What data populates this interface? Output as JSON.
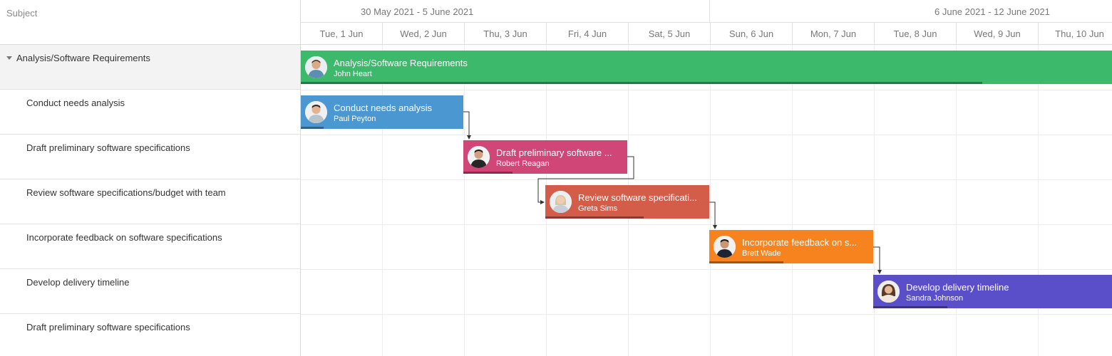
{
  "tree": {
    "header": "Subject",
    "rows": [
      {
        "label": "Analysis/Software Requirements",
        "parent": true
      },
      {
        "label": "Conduct needs analysis"
      },
      {
        "label": "Draft preliminary software specifications"
      },
      {
        "label": "Review software specifications/budget with team"
      },
      {
        "label": "Incorporate feedback on software specifications"
      },
      {
        "label": "Develop delivery timeline"
      },
      {
        "label": "Draft preliminary software specifications"
      }
    ]
  },
  "timeline": {
    "weeks": [
      "30 May 2021 - 5 June 2021",
      "6 June 2021 - 12 June 2021"
    ],
    "days": [
      "Tue, 1 Jun",
      "Wed, 2 Jun",
      "Thu, 3 Jun",
      "Fri, 4 Jun",
      "Sat, 5 Jun",
      "Sun, 6 Jun",
      "Mon, 7 Jun",
      "Tue, 8 Jun",
      "Wed, 9 Jun",
      "Thu, 10 Jun"
    ]
  },
  "tasks": [
    {
      "title": "Analysis/Software Requirements",
      "owner": "John Heart",
      "color": "#3cb96b",
      "progress": 0.84
    },
    {
      "title": "Conduct needs analysis",
      "owner": "Paul Peyton",
      "color": "#4a97d2",
      "progress": 0.14
    },
    {
      "title": "Draft preliminary software ...",
      "owner": "Robert Reagan",
      "color": "#cf4677",
      "progress": 0.3
    },
    {
      "title": "Review software specificati...",
      "owner": "Greta Sims",
      "color": "#d45d4a",
      "progress": 0.6
    },
    {
      "title": "Incorporate feedback on s...",
      "owner": "Brett Wade",
      "color": "#f7831f",
      "progress": 0.45
    },
    {
      "title": "Develop delivery timeline",
      "owner": "Sandra Johnson",
      "color": "#5a4fc8",
      "progress": 0.31
    }
  ]
}
